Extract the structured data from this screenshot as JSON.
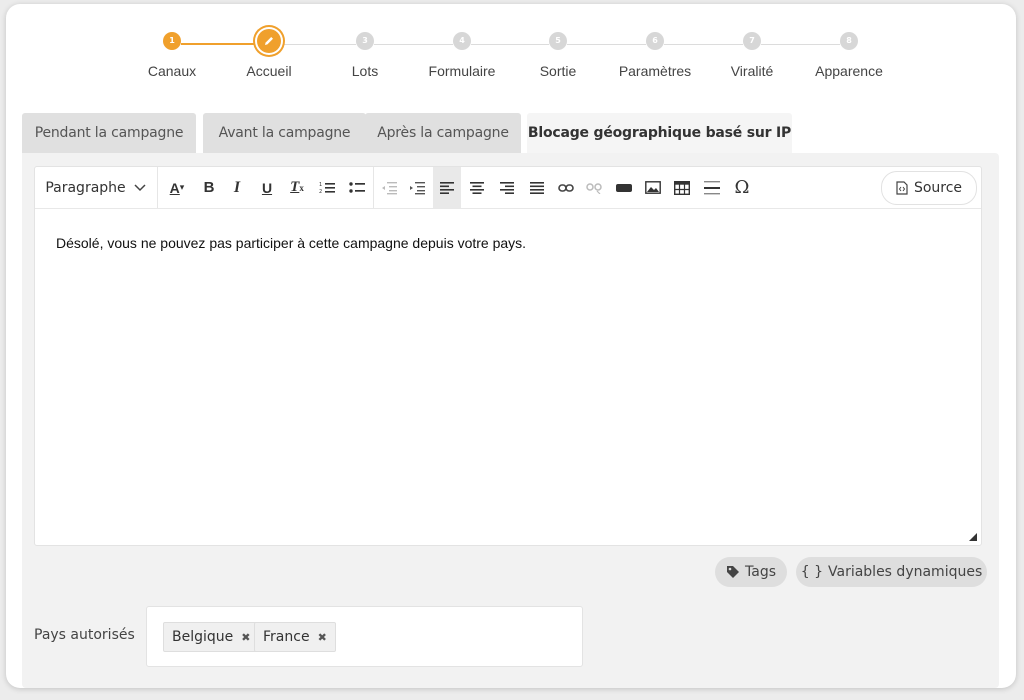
{
  "stepper": {
    "steps": [
      {
        "number": "1",
        "label": "Canaux"
      },
      {
        "number": "2",
        "label": "Accueil"
      },
      {
        "number": "3",
        "label": "Lots"
      },
      {
        "number": "4",
        "label": "Formulaire"
      },
      {
        "number": "5",
        "label": "Sortie"
      },
      {
        "number": "6",
        "label": "Paramètres"
      },
      {
        "number": "7",
        "label": "Viralité"
      },
      {
        "number": "8",
        "label": "Apparence"
      }
    ],
    "accent_color": "#f0a02c"
  },
  "tabs": [
    {
      "label": "Pendant la campagne"
    },
    {
      "label": "Avant la campagne"
    },
    {
      "label": "Après la campagne"
    },
    {
      "label": "Blocage géographique basé sur IP"
    }
  ],
  "editor": {
    "paragraph_format": "Paragraphe",
    "source_label": "Source",
    "content": "Désolé, vous ne pouvez pas participer à cette campagne depuis votre pays.",
    "toolbar_icons": [
      "font-color-icon",
      "bold-icon",
      "italic-icon",
      "underline-icon",
      "remove-format-icon",
      "numbered-list-icon",
      "bulleted-list-icon",
      "outdent-icon",
      "indent-icon",
      "align-left-icon",
      "align-center-icon",
      "align-right-icon",
      "justify-icon",
      "link-icon",
      "unlink-icon",
      "button-icon",
      "image-icon",
      "table-icon",
      "horizontal-line-icon",
      "special-character-icon"
    ]
  },
  "actions": {
    "tags_label": "Tags",
    "variables_label": "Variables dynamiques",
    "variables_icon": "{ }"
  },
  "countries": {
    "label": "Pays autorisés",
    "chips": [
      "Belgique",
      "France"
    ],
    "remove_glyph": "✖"
  }
}
